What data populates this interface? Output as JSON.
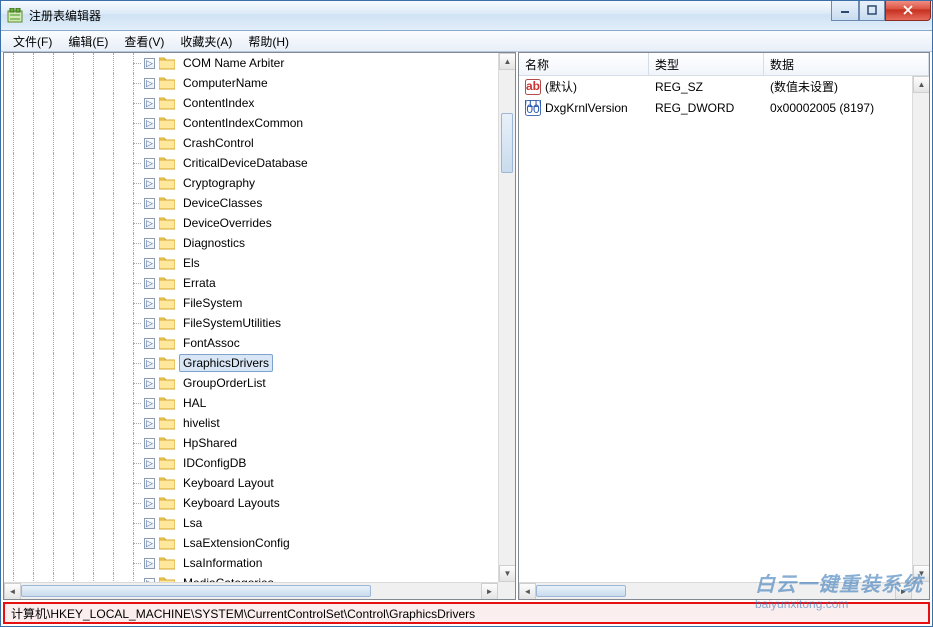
{
  "window": {
    "title": "注册表编辑器"
  },
  "menu": {
    "file": "文件(F)",
    "edit": "编辑(E)",
    "view": "查看(V)",
    "favorites": "收藏夹(A)",
    "help": "帮助(H)"
  },
  "tree": {
    "indent": 6,
    "items": [
      {
        "label": "COM Name Arbiter"
      },
      {
        "label": "ComputerName"
      },
      {
        "label": "ContentIndex"
      },
      {
        "label": "ContentIndexCommon"
      },
      {
        "label": "CrashControl"
      },
      {
        "label": "CriticalDeviceDatabase"
      },
      {
        "label": "Cryptography"
      },
      {
        "label": "DeviceClasses"
      },
      {
        "label": "DeviceOverrides"
      },
      {
        "label": "Diagnostics"
      },
      {
        "label": "Els"
      },
      {
        "label": "Errata"
      },
      {
        "label": "FileSystem"
      },
      {
        "label": "FileSystemUtilities"
      },
      {
        "label": "FontAssoc"
      },
      {
        "label": "GraphicsDrivers",
        "selected": true
      },
      {
        "label": "GroupOrderList"
      },
      {
        "label": "HAL"
      },
      {
        "label": "hivelist"
      },
      {
        "label": "HpShared"
      },
      {
        "label": "IDConfigDB"
      },
      {
        "label": "Keyboard Layout"
      },
      {
        "label": "Keyboard Layouts"
      },
      {
        "label": "Lsa"
      },
      {
        "label": "LsaExtensionConfig"
      },
      {
        "label": "LsaInformation"
      },
      {
        "label": "MediaCategories"
      }
    ]
  },
  "list": {
    "columns": {
      "name": "名称",
      "type": "类型",
      "data": "数据"
    },
    "col_widths": {
      "name": 130,
      "type": 115,
      "data": 140
    },
    "rows": [
      {
        "icon": "ab",
        "name": "(默认)",
        "type": "REG_SZ",
        "data": "(数值未设置)"
      },
      {
        "icon": "bin",
        "name": "DxgKrnlVersion",
        "type": "REG_DWORD",
        "data": "0x00002005 (8197)"
      }
    ]
  },
  "status": {
    "path": "计算机\\HKEY_LOCAL_MACHINE\\SYSTEM\\CurrentControlSet\\Control\\GraphicsDrivers"
  },
  "watermark": {
    "cn": "白云一键重装系统",
    "en": "baiyunxitong.com"
  }
}
